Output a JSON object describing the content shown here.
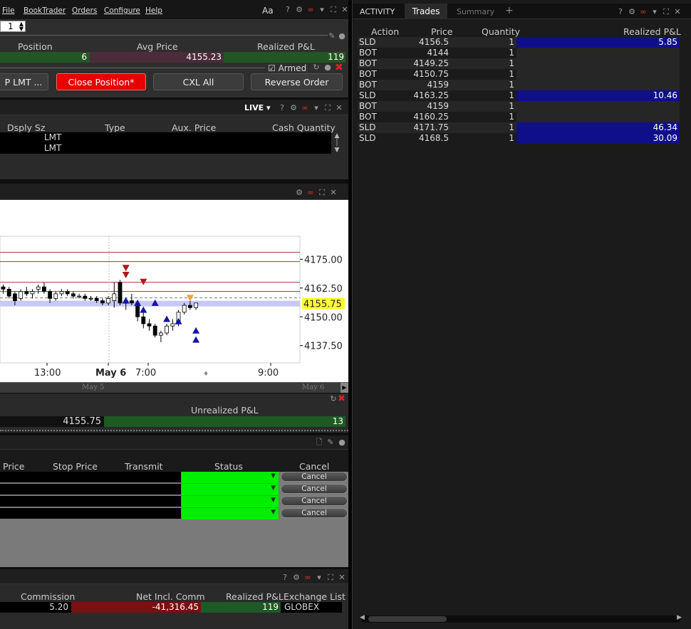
{
  "menu": {
    "file": "File",
    "booktrader": "BookTrader",
    "orders": "Orders",
    "configure": "Configure",
    "help": "Help",
    "font": "Aa"
  },
  "order_entry": {
    "qty": "1",
    "position_label": "Position",
    "avg_label": "Avg Price",
    "rpnl_label": "Realized P&L",
    "position": "6",
    "avg_price": "4155.23",
    "rpnl": "119",
    "armed": "Armed",
    "btn_lmt": "P LMT ...",
    "btn_close": "Close Position*",
    "btn_cxl": "CXL All",
    "btn_reverse": "Reverse Order"
  },
  "live_panel": {
    "live": "LIVE",
    "cols": [
      "Dsply Sz",
      "Type",
      "Aux. Price",
      "Cash Quantity"
    ],
    "rows": [
      {
        "type": "LMT"
      },
      {
        "type": "LMT"
      }
    ]
  },
  "chart_data": {
    "type": "candlestick",
    "y_ticks": [
      "4175.00",
      "4162.50",
      "4150.00",
      "4137.50"
    ],
    "ylim": [
      4130,
      4185
    ],
    "x_ticks": [
      "13:00",
      "May 6",
      "7:00",
      "9:00"
    ],
    "last_price": "4155.75",
    "timeline": [
      "May 5",
      "May 6"
    ],
    "ref_lines": [
      4178,
      4174,
      4165,
      4161
    ],
    "candles": [
      {
        "o": 4163,
        "h": 4164,
        "l": 4160,
        "c": 4162
      },
      {
        "o": 4162,
        "h": 4163,
        "l": 4158,
        "c": 4159
      },
      {
        "o": 4160,
        "h": 4161,
        "l": 4155,
        "c": 4157
      },
      {
        "o": 4158,
        "h": 4162,
        "l": 4157,
        "c": 4161
      },
      {
        "o": 4161,
        "h": 4163,
        "l": 4159,
        "c": 4160
      },
      {
        "o": 4160,
        "h": 4162,
        "l": 4158,
        "c": 4161
      },
      {
        "o": 4162,
        "h": 4164,
        "l": 4160,
        "c": 4163
      },
      {
        "o": 4163,
        "h": 4165,
        "l": 4160,
        "c": 4161
      },
      {
        "o": 4161,
        "h": 4162,
        "l": 4156,
        "c": 4158
      },
      {
        "o": 4158,
        "h": 4161,
        "l": 4157,
        "c": 4160
      },
      {
        "o": 4160,
        "h": 4162,
        "l": 4159,
        "c": 4161
      },
      {
        "o": 4161,
        "h": 4162,
        "l": 4159,
        "c": 4160
      },
      {
        "o": 4160,
        "h": 4161,
        "l": 4158,
        "c": 4159
      },
      {
        "o": 4159,
        "h": 4160,
        "l": 4158,
        "c": 4159
      },
      {
        "o": 4159,
        "h": 4160,
        "l": 4157,
        "c": 4158
      },
      {
        "o": 4158,
        "h": 4159,
        "l": 4157,
        "c": 4158
      },
      {
        "o": 4158,
        "h": 4159,
        "l": 4156,
        "c": 4157
      },
      {
        "o": 4157,
        "h": 4158,
        "l": 4155,
        "c": 4156
      },
      {
        "o": 4156,
        "h": 4159,
        "l": 4155,
        "c": 4158
      },
      {
        "o": 4157,
        "h": 4165,
        "l": 4154,
        "c": 4160
      },
      {
        "o": 4165,
        "h": 4166,
        "l": 4155,
        "c": 4156
      },
      {
        "o": 4156,
        "h": 4158,
        "l": 4153,
        "c": 4157
      },
      {
        "o": 4157,
        "h": 4160,
        "l": 4155,
        "c": 4156
      },
      {
        "o": 4156,
        "h": 4157,
        "l": 4148,
        "c": 4150
      },
      {
        "o": 4150,
        "h": 4152,
        "l": 4145,
        "c": 4147
      },
      {
        "o": 4147,
        "h": 4149,
        "l": 4144,
        "c": 4146
      },
      {
        "o": 4146,
        "h": 4147,
        "l": 4141,
        "c": 4142
      },
      {
        "o": 4142,
        "h": 4144,
        "l": 4139,
        "c": 4143
      },
      {
        "o": 4143,
        "h": 4147,
        "l": 4142,
        "c": 4146
      },
      {
        "o": 4146,
        "h": 4149,
        "l": 4144,
        "c": 4147
      },
      {
        "o": 4147,
        "h": 4153,
        "l": 4146,
        "c": 4152
      },
      {
        "o": 4152,
        "h": 4156,
        "l": 4151,
        "c": 4155
      },
      {
        "o": 4155,
        "h": 4157,
        "l": 4153,
        "c": 4154
      },
      {
        "o": 4154,
        "h": 4156,
        "l": 4153,
        "c": 4156
      }
    ],
    "sell_markers": [
      {
        "i": 21,
        "p": 4168
      },
      {
        "i": 21,
        "p": 4171
      },
      {
        "i": 24,
        "p": 4165
      },
      {
        "i": 32,
        "p": 4158
      }
    ],
    "buy_markers": [
      {
        "i": 21,
        "p": 4157
      },
      {
        "i": 23,
        "p": 4156
      },
      {
        "i": 24,
        "p": 4153
      },
      {
        "i": 26,
        "p": 4156
      },
      {
        "i": 28,
        "p": 4149
      },
      {
        "i": 30,
        "p": 4148
      },
      {
        "i": 33,
        "p": 4144
      },
      {
        "i": 33,
        "p": 4140
      }
    ]
  },
  "pnl_panel": {
    "label": "Unrealized P&L",
    "price": "4155.75",
    "value": "13"
  },
  "orders_panel": {
    "cols": [
      "Price",
      "Stop Price",
      "Transmit",
      "Status",
      "Cancel"
    ],
    "cancel_label": "Cancel",
    "rows": 4
  },
  "trades_summary": {
    "cols": [
      "Commission",
      "Net Incl. Comm",
      "Realized P&L",
      "Exchange List"
    ],
    "commission": "5.20",
    "net": "-41,316.45",
    "rpnl": "119",
    "exchange": "GLOBEX"
  },
  "right_panel": {
    "tabs": [
      "ACTIVITY",
      "Trades",
      "Summary"
    ],
    "cols": [
      "Action",
      "Price",
      "Quantity",
      "Realized P&L"
    ],
    "trades": [
      {
        "action": "SLD",
        "price": "4156.5",
        "qty": "1",
        "pnl": "5.85"
      },
      {
        "action": "BOT",
        "price": "4144",
        "qty": "1",
        "pnl": ""
      },
      {
        "action": "BOT",
        "price": "4149.25",
        "qty": "1",
        "pnl": ""
      },
      {
        "action": "BOT",
        "price": "4150.75",
        "qty": "1",
        "pnl": ""
      },
      {
        "action": "BOT",
        "price": "4159",
        "qty": "1",
        "pnl": ""
      },
      {
        "action": "SLD",
        "price": "4163.25",
        "qty": "1",
        "pnl": "10.46"
      },
      {
        "action": "BOT",
        "price": "4159",
        "qty": "1",
        "pnl": ""
      },
      {
        "action": "BOT",
        "price": "4160.25",
        "qty": "1",
        "pnl": ""
      },
      {
        "action": "SLD",
        "price": "4171.75",
        "qty": "1",
        "pnl": "46.34"
      },
      {
        "action": "SLD",
        "price": "4168.5",
        "qty": "1",
        "pnl": "30.09"
      }
    ]
  }
}
